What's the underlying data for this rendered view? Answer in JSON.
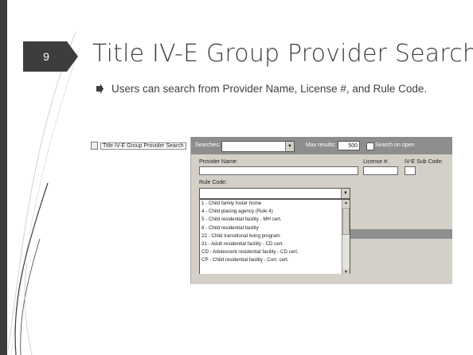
{
  "slide": {
    "number": "9",
    "title": "Title IV-E Group Provider Search",
    "bullet": "Users can search from Provider Name, License #, and Rule Code."
  },
  "screenshot": {
    "tree_item": "Title IV-E Group Provider Search",
    "searches_label": "Searches:",
    "max_results_label": "Max results:",
    "max_results_value": "500",
    "search_on_open_label": "Search on open",
    "provider_name_label": "Provider Name:",
    "license_label": "License #:",
    "sub_code_label": "IV-E Sub Code:",
    "rule_code_label": "Rule Code:",
    "rule_codes": [
      "1 - Child family foster home",
      "4 - Child placing agency (Rule 4)",
      "5 - Child residential facility - MH cert.",
      "8 - Child residential facility",
      "22 - Child transitional living program",
      "31 - Adult residential facility - CD cert.",
      "CD - Adolescent residential facility - CD cert.",
      "CP - Child residential facility - Corr. cert."
    ]
  },
  "colors": {
    "accent": "#3d3d3d",
    "title_text": "#3b3b3b"
  }
}
